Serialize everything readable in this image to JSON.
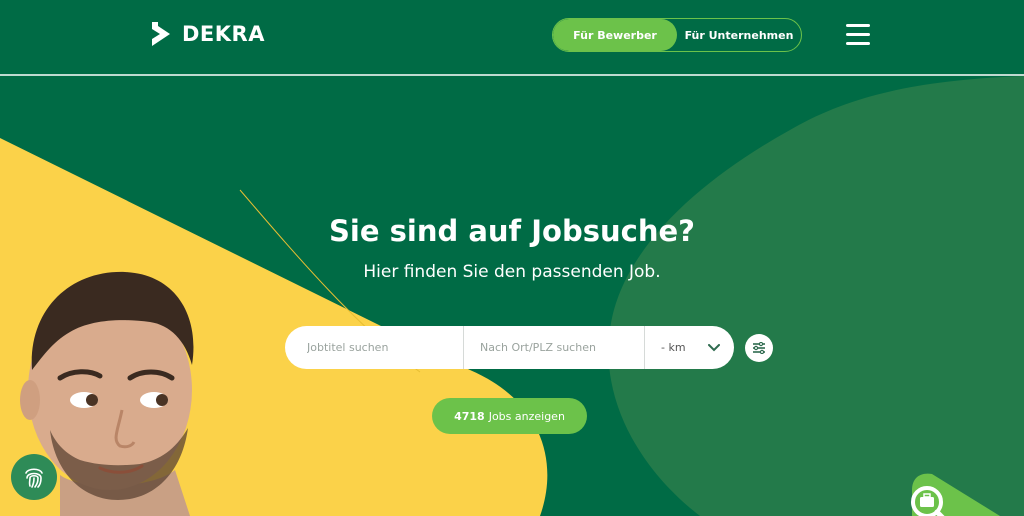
{
  "brand": {
    "name": "DEKRA"
  },
  "header": {
    "toggle": {
      "applicants_label": "Für Bewerber",
      "companies_label": "Für Unternehmen",
      "active": "applicants"
    },
    "menu_icon": "hamburger-menu-icon"
  },
  "hero": {
    "title": "Sie sind auf Jobsuche?",
    "subtitle": "Hier finden Sie den passenden Job."
  },
  "search": {
    "job_placeholder": "Jobtitel suchen",
    "location_placeholder": "Nach Ort/PLZ suchen",
    "radius_value": "- km",
    "filter_icon": "sliders-icon"
  },
  "cta": {
    "count": "4718",
    "label": "Jobs anzeigen"
  },
  "floating": {
    "fingerprint_icon": "fingerprint-icon",
    "job_search_icon": "briefcase-search-icon"
  },
  "colors": {
    "dark_green": "#006b45",
    "mid_green": "#237a4a",
    "accent_green": "#6cc24a",
    "yellow": "#fbd249",
    "white": "#ffffff"
  }
}
